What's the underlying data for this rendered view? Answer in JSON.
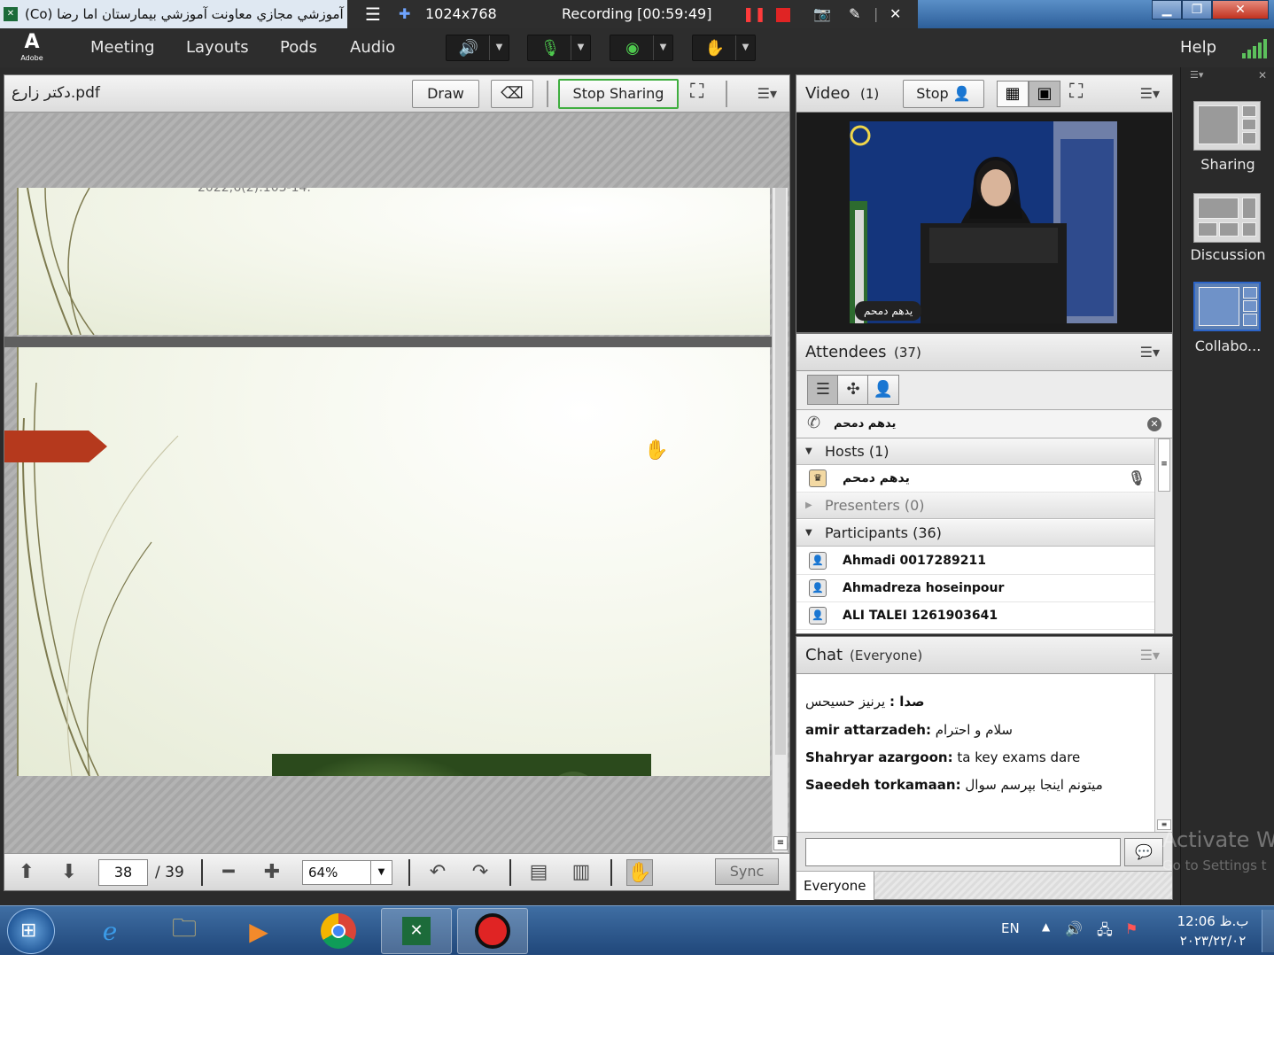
{
  "window": {
    "title": "(Co) كلاس آموزشي مجازي معاونت آموزشي بيمارستان اما رضا",
    "app_icon": "adobe-connect-icon"
  },
  "recording": {
    "resolution": "1024x768",
    "status": "Recording [00:59:49]"
  },
  "menu": {
    "logo_label": "Adobe",
    "items": [
      "Meeting",
      "Layouts",
      "Pods",
      "Audio"
    ],
    "help": "Help"
  },
  "share_pod": {
    "filename": "دکتر زارع.pdf",
    "draw_label": "Draw",
    "stop_sharing_label": "Stop Sharing",
    "slide_citation": "2022;6(2):103-14.",
    "page": "38",
    "total": "/ 39",
    "zoom": "64%",
    "sync_label": "Sync",
    "accent_color": "#3fae3f"
  },
  "video_pod": {
    "title": "Video",
    "count": "(1)",
    "stop_label": "Stop",
    "presenter_name": "یدهم دمحم"
  },
  "attendees_pod": {
    "title": "Attendees",
    "count": "(37)",
    "active_speaker": "یدهم دمحم",
    "groups": {
      "hosts": "Hosts (1)",
      "presenters": "Presenters (0)",
      "participants": "Participants (36)"
    },
    "host": "یدهم دمحم",
    "participants": [
      "Ahmadi 0017289211",
      "Ahmadreza hoseinpour",
      "ALI TALEI 1261903641"
    ]
  },
  "chat_pod": {
    "title": "Chat",
    "scope": "(Everyone)",
    "messages": [
      {
        "sender": "صدا :",
        "text": "یرنیز حسیحس"
      },
      {
        "sender": "amir attarzadeh:",
        "text": "سلام و احترام"
      },
      {
        "sender": "Shahryar azargoon:",
        "text": "ta key exams dare"
      },
      {
        "sender": "Saeedeh torkamaan:",
        "text": "میتونم اینجا بپرسم سوال"
      }
    ],
    "tab_everyone": "Everyone"
  },
  "layouts_panel": {
    "items": [
      "Sharing",
      "Discussion",
      "Collabo..."
    ],
    "selected": "Collabo..."
  },
  "watermark": {
    "line1": "Activate Wi",
    "line2": "Go to Settings t"
  },
  "taskbar": {
    "lang": "EN",
    "time": "12:06 ب.ظ",
    "date": "۲۰۲۳/۲۲/۰۲"
  }
}
